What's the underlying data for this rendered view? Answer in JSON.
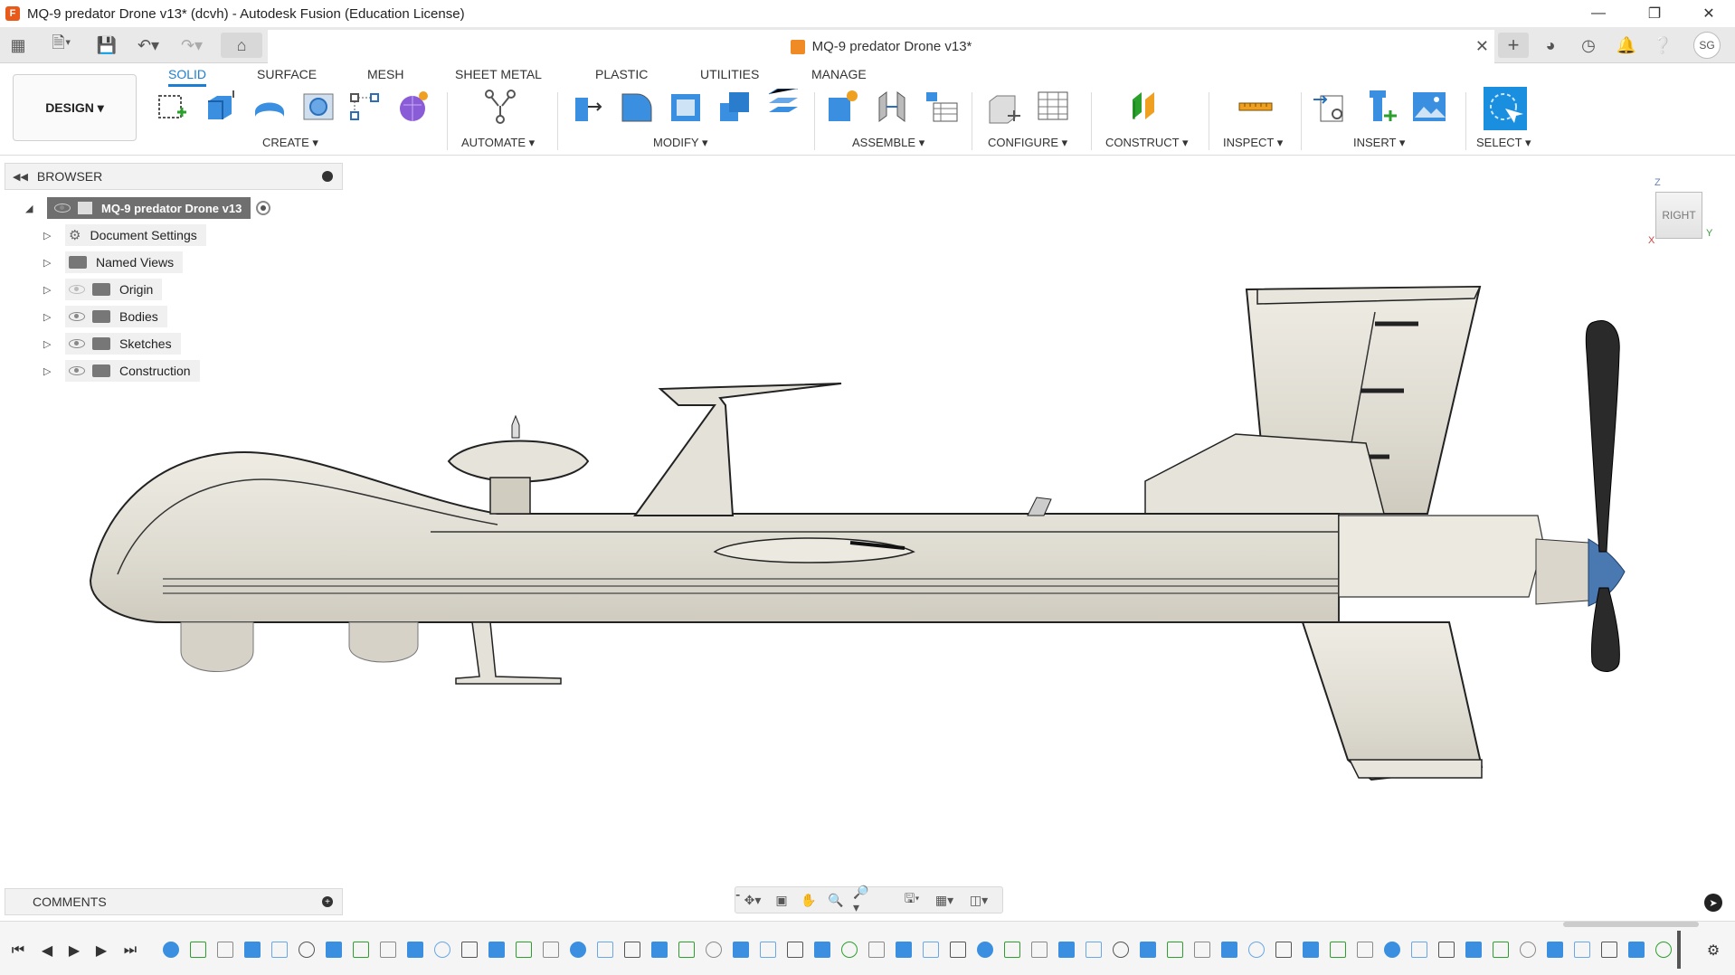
{
  "window": {
    "title": "MQ-9 predator Drone v13* (dcvh) - Autodesk Fusion (Education License)"
  },
  "document_tab": {
    "title": "MQ-9 predator Drone v13*"
  },
  "workspace": {
    "label": "DESIGN"
  },
  "ribbon": {
    "tabs": [
      "SOLID",
      "SURFACE",
      "MESH",
      "SHEET METAL",
      "PLASTIC",
      "UTILITIES",
      "MANAGE"
    ],
    "active_tab": "SOLID",
    "groups": [
      "CREATE",
      "AUTOMATE",
      "MODIFY",
      "ASSEMBLE",
      "CONFIGURE",
      "CONSTRUCT",
      "INSPECT",
      "INSERT",
      "SELECT"
    ]
  },
  "user": {
    "initials": "SG"
  },
  "browser": {
    "title": "BROWSER",
    "root": "MQ-9 predator Drone v13",
    "items": [
      {
        "label": "Document Settings",
        "icon": "gear-icon"
      },
      {
        "label": "Named Views",
        "icon": "folder-icon"
      },
      {
        "label": "Origin",
        "icon": "folder-icon",
        "eye": "hidden"
      },
      {
        "label": "Bodies",
        "icon": "folder-icon",
        "eye": "visible"
      },
      {
        "label": "Sketches",
        "icon": "folder-icon",
        "eye": "visible"
      },
      {
        "label": "Construction",
        "icon": "folder-icon",
        "eye": "visible"
      }
    ]
  },
  "comments": {
    "title": "COMMENTS"
  },
  "viewcube": {
    "face": "RIGHT",
    "axis_z": "Z",
    "axis_y": "Y",
    "axis_x": "X"
  },
  "colors": {
    "accent": "#1a7fd4",
    "model_body": "#e4e1d8",
    "propeller": "#2a2a2a",
    "spinner": "#4a78b0"
  }
}
